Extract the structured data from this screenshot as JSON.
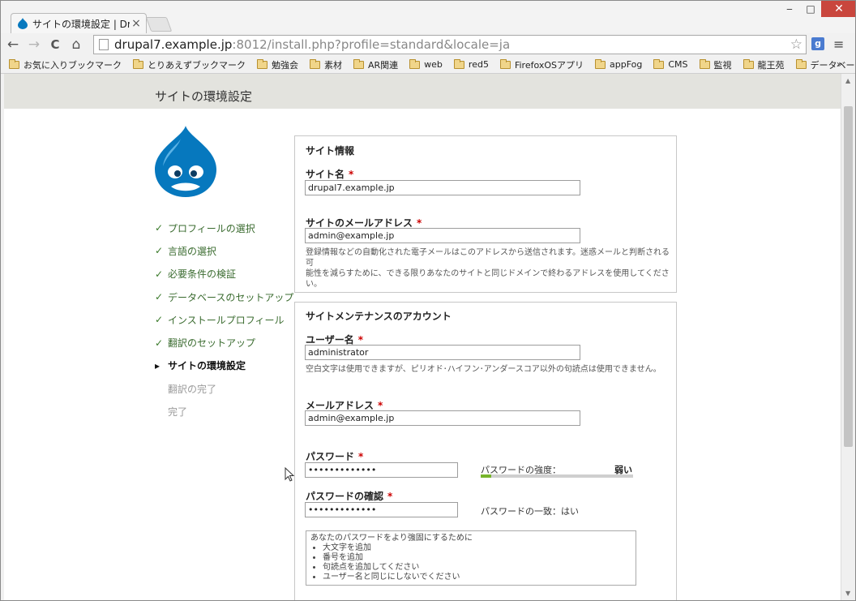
{
  "tab": {
    "title": "サイトの環境設定 | Drupal",
    "close": "×"
  },
  "window_controls": {
    "minimize": "‒",
    "maximize": "□",
    "close": "✕"
  },
  "toolbar": {
    "back": "←",
    "forward": "→",
    "reload": "C",
    "home": "⌂",
    "url_host": "drupal7.example.jp",
    "url_rest": ":8012/install.php?profile=standard&locale=ja",
    "star": "☆",
    "ext": "g",
    "menu": "≡"
  },
  "bookmarks": {
    "items": [
      "お気に入りブックマーク",
      "とりあえずブックマーク",
      "勉強会",
      "素材",
      "AR関連",
      "web",
      "red5",
      "FirefoxOSアプリ",
      "appFog",
      "CMS",
      "監視",
      "龍王苑",
      "データベース"
    ],
    "more": "»"
  },
  "page": {
    "title": "サイトの環境設定"
  },
  "tasks": [
    {
      "label": "プロフィールの選択",
      "mark": "✓",
      "state": "done"
    },
    {
      "label": "言語の選択",
      "mark": "✓",
      "state": "done"
    },
    {
      "label": "必要条件の検証",
      "mark": "✓",
      "state": "done"
    },
    {
      "label": "データベースのセットアップ",
      "mark": "✓",
      "state": "done"
    },
    {
      "label": "インストールプロフィール",
      "mark": "✓",
      "state": "done"
    },
    {
      "label": "翻訳のセットアップ",
      "mark": "✓",
      "state": "done"
    },
    {
      "label": "サイトの環境設定",
      "mark": "▸",
      "state": "active"
    },
    {
      "label": "翻訳の完了",
      "mark": "",
      "state": "pending"
    },
    {
      "label": "完了",
      "mark": "",
      "state": "pending"
    }
  ],
  "site_info": {
    "legend": "サイト情報",
    "site_name_label": "サイト名",
    "site_name_value": "drupal7.example.jp",
    "site_mail_label": "サイトのメールアドレス",
    "site_mail_value": "admin@example.jp",
    "site_mail_desc_1": "登録情報などの自動化された電子メールはこのアドレスから送信されます。迷惑メールと判断される可",
    "site_mail_desc_2": "能性を減らすために、できる限りあなたのサイトと同じドメインで終わるアドレスを使用してください。"
  },
  "account": {
    "legend": "サイトメンテナンスのアカウント",
    "username_label": "ユーザー名",
    "username_value": "administrator",
    "username_desc": "空白文字は使用できますが、ピリオド･ハイフン･アンダースコア以外の句読点は使用できません。",
    "mail_label": "メールアドレス",
    "mail_value": "admin@example.jp",
    "pass_label": "パスワード",
    "pass_value": "•••••••••••••",
    "strength_label": "パスワードの強度：",
    "strength_value": "弱い",
    "strength_level": 0.07,
    "confirm_label": "パスワードの確認",
    "confirm_value": "•••••••••••••",
    "match_text": "パスワードの一致：はい",
    "suggest_title": "あなたのパスワードをより強固にするために",
    "suggest_items": [
      "大文字を追加",
      "番号を追加",
      "句読点を追加してください",
      "ユーザー名と同じにしないでください"
    ]
  },
  "required_mark": "*",
  "colors": {
    "header_band": "#e3e3de",
    "done_green": "#3a6b2f",
    "required_red": "#cc0000",
    "drupal_blue": "#0678be",
    "strength_green": "#77b52c"
  }
}
